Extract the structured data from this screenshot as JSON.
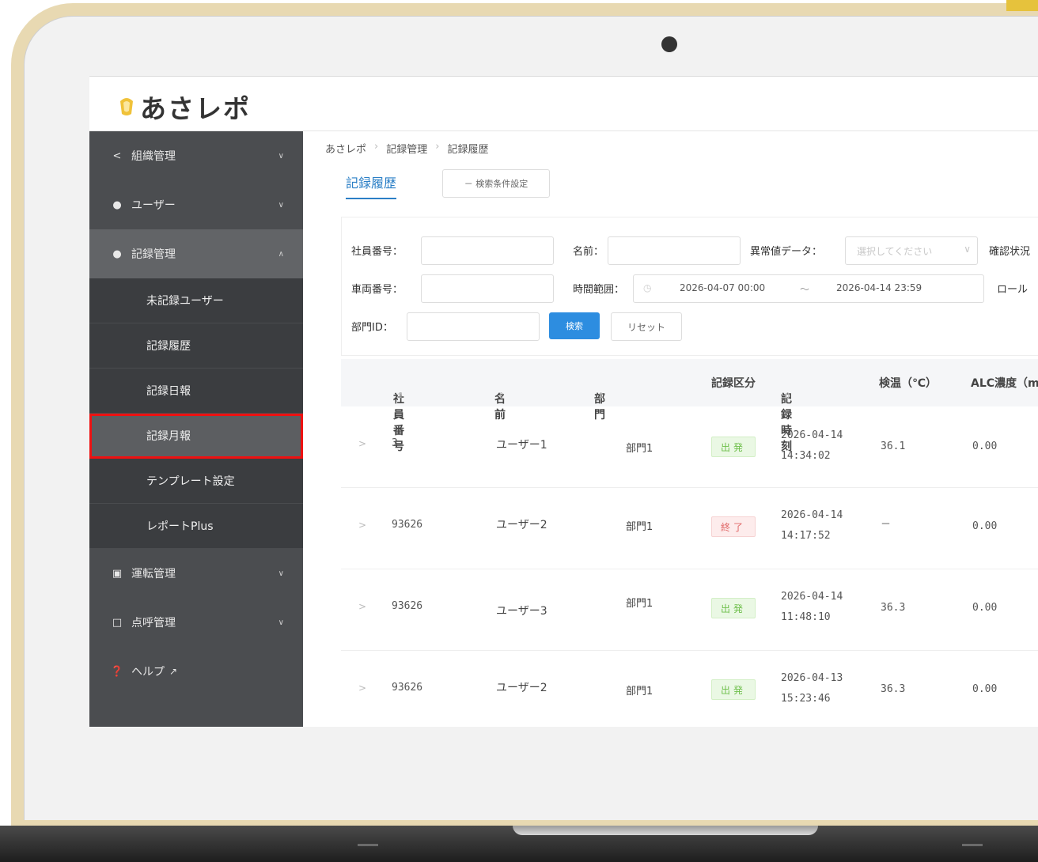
{
  "app": {
    "logo_text": "あさレポ"
  },
  "sidebar": {
    "items": [
      {
        "label": "組織管理",
        "icon": "share-icon"
      },
      {
        "label": "ユーザー",
        "icon": "user-icon"
      },
      {
        "label": "記録管理",
        "icon": "user-icon"
      },
      {
        "label": "運転管理",
        "icon": "video-icon"
      },
      {
        "label": "点呼管理",
        "icon": "camera-icon"
      },
      {
        "label": "ヘルプ",
        "icon": "help-icon"
      }
    ],
    "sub_items": [
      "未記録ユーザー",
      "記録履歴",
      "記録日報",
      "記録月報",
      "テンプレート設定",
      "レポートPlus"
    ]
  },
  "breadcrumb": [
    "あさレポ",
    "記録管理",
    "記録履歴"
  ],
  "tab": {
    "active": "記録履歴",
    "condition_button": "－ 検索条件設定"
  },
  "filters": {
    "employee_no": "社員番号：",
    "name": "名前：",
    "abnormal": "異常値データ：",
    "abnormal_placeholder": "選択してください",
    "confirm_status": "確認状況",
    "vehicle_no": "車両番号：",
    "time_range": "時間範囲：",
    "date_start": "2026-04-07 00:00",
    "date_sep": "～",
    "date_end": "2026-04-14 23:59",
    "role": "ロール",
    "dept_id": "部門ID：",
    "search": "検索",
    "reset": "リセット"
  },
  "table": {
    "headers": [
      "社員番号",
      "名前",
      "部門",
      "記録区分",
      "記録時刻",
      "検温（℃）",
      "ALC濃度（mg"
    ],
    "rows": [
      {
        "emp": "3",
        "name": "ユーザー1",
        "dept": "部門1",
        "type": "出発",
        "kind": "dep",
        "date": "2026-04-14",
        "time": "14:34:02",
        "temp": "36.1",
        "alc": "0.00"
      },
      {
        "emp": "93626",
        "name": "ユーザー2",
        "dept": "部門1",
        "type": "終了",
        "kind": "end",
        "date": "2026-04-14",
        "time": "14:17:52",
        "temp": "－",
        "alc": "0.00"
      },
      {
        "emp": "93626",
        "name": "ユーザー3",
        "dept": "部門1",
        "type": "出発",
        "kind": "dep",
        "date": "2026-04-14",
        "time": "11:48:10",
        "temp": "36.3",
        "alc": "0.00"
      },
      {
        "emp": "93626",
        "name": "ユーザー2",
        "dept": "部門1",
        "type": "出発",
        "kind": "dep",
        "date": "2026-04-13",
        "time": "15:23:46",
        "temp": "36.3",
        "alc": "0.00"
      }
    ]
  },
  "colors": {
    "accent": "#2d8de0",
    "sidebar": "#4b4d50",
    "highlight": "#ee1111",
    "frame": "#e8d9b2"
  }
}
